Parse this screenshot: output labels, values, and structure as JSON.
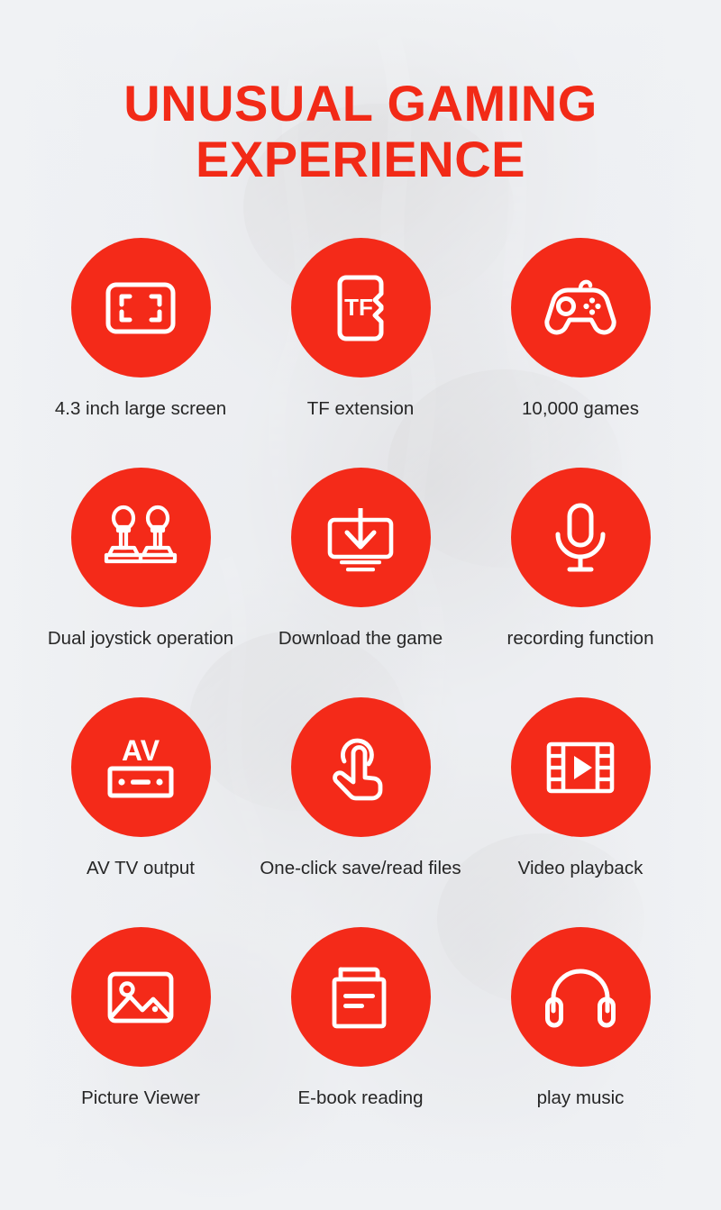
{
  "theme": {
    "accent_red": "#F42A19",
    "icon_stroke": "#FFFFFF",
    "caption_color": "#262626",
    "background": "#eceef1"
  },
  "heading": {
    "line1": "UNUSUAL GAMING",
    "line2": "EXPERIENCE"
  },
  "features": [
    {
      "icon": "fullscreen-screen-icon",
      "label": "4.3 inch large screen"
    },
    {
      "icon": "tf-memory-card-icon",
      "label": "TF extension"
    },
    {
      "icon": "gamepad-icon",
      "label": "10,000 games"
    },
    {
      "icon": "dual-joystick-icon",
      "label": "Dual joystick operation"
    },
    {
      "icon": "download-to-screen-icon",
      "label": "Download the game"
    },
    {
      "icon": "microphone-icon",
      "label": "recording function"
    },
    {
      "icon": "av-output-icon",
      "label": "AV TV output"
    },
    {
      "icon": "touch-hand-tap-icon",
      "label": "One-click save/read files"
    },
    {
      "icon": "film-play-icon",
      "label": "Video playback"
    },
    {
      "icon": "picture-image-icon",
      "label": "Picture Viewer"
    },
    {
      "icon": "book-document-icon",
      "label": "E-book reading"
    },
    {
      "icon": "headphones-icon",
      "label": "play music"
    }
  ],
  "icon_text": {
    "tf_card": "TF",
    "av_output": "AV"
  }
}
